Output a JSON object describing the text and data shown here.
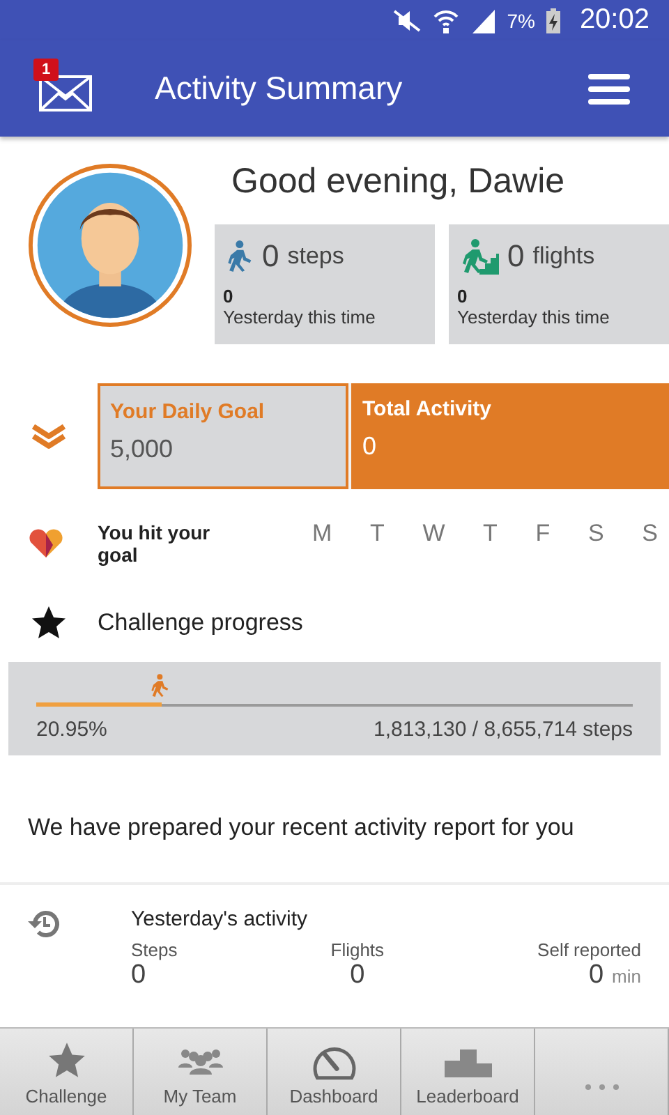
{
  "status_bar": {
    "battery": "7%",
    "time": "20:02"
  },
  "app_bar": {
    "badge": "1",
    "title": "Activity Summary"
  },
  "greeting": "Good evening, Dawie",
  "stats": [
    {
      "kind": "steps",
      "value": "0",
      "unit": "steps",
      "yesterday": "0",
      "caption": "Yesterday this time"
    },
    {
      "kind": "flights",
      "value": "0",
      "unit": "flights",
      "yesterday": "0",
      "caption": "Yesterday this time"
    }
  ],
  "goal": {
    "label": "Your Daily Goal",
    "value": "5,000"
  },
  "total": {
    "label": "Total Activity",
    "value": "0"
  },
  "hit_goal": {
    "label": "You hit your goal",
    "days": [
      "M",
      "T",
      "W",
      "T",
      "F",
      "S",
      "S"
    ]
  },
  "challenge": {
    "title": "Challenge progress",
    "level": 0.2095,
    "percent": "20.95%",
    "reading": "1,813,130 / 8,655,714 steps"
  },
  "report_message": "We have prepared your recent activity report for you",
  "yesterday": {
    "title": "Yesterday's activity",
    "columns": [
      {
        "label": "Steps",
        "value": "0"
      },
      {
        "label": "Flights",
        "value": "0"
      },
      {
        "label": "Self reported",
        "value": "0",
        "unit": "min"
      }
    ]
  },
  "bottom_nav": [
    {
      "kind": "star",
      "label": "Challenge",
      "selected": false
    },
    {
      "kind": "team",
      "label": "My Team",
      "selected": false
    },
    {
      "kind": "gauge",
      "label": "Dashboard",
      "selected": false
    },
    {
      "kind": "podium",
      "label": "Leaderboard",
      "selected": false
    },
    {
      "kind": "more",
      "selected": false
    }
  ]
}
